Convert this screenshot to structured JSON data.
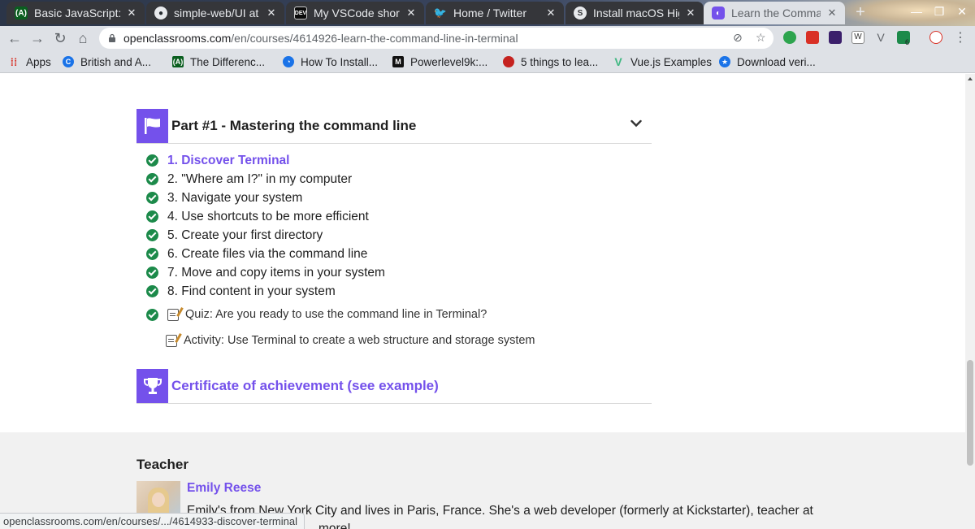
{
  "tabs": [
    {
      "title": "Basic JavaScript: Ac",
      "favicon": "freecodecamp-icon",
      "active": false
    },
    {
      "title": "simple-web/UI at m",
      "favicon": "github-icon",
      "active": false
    },
    {
      "title": "My VSCode shortcu",
      "favicon": "dev-icon",
      "active": false
    },
    {
      "title": "Home / Twitter",
      "favicon": "twitter-icon",
      "active": false
    },
    {
      "title": "Install macOS High",
      "favicon": "globe-icon",
      "active": false
    },
    {
      "title": "Learn the Comman",
      "favicon": "openclassrooms-icon",
      "active": true
    }
  ],
  "toolbar": {
    "url_host": "openclassrooms.com",
    "url_path": "/en/courses/4614926-learn-the-command-line-in-terminal"
  },
  "bookmarks": [
    {
      "label": "Apps",
      "icon": "apps-grid-icon"
    },
    {
      "label": "British and A...",
      "icon": "dictionary-icon"
    },
    {
      "label": "The Differenc...",
      "icon": "freecodecamp-icon"
    },
    {
      "label": "How To Install...",
      "icon": "digitalocean-icon"
    },
    {
      "label": "Powerlevel9k:...",
      "icon": "medium-icon"
    },
    {
      "label": "5 things to lea...",
      "icon": "red-circle-icon"
    },
    {
      "label": "Vue.js Examples",
      "icon": "vue-icon"
    },
    {
      "label": "Download veri...",
      "icon": "star-badge-icon"
    }
  ],
  "part": {
    "title": "Part #1 - Mastering the command line",
    "chapters": [
      "1. Discover Terminal",
      "2. \"Where am I?\" in my computer",
      "3. Navigate your system",
      "4. Use shortcuts to be more efficient",
      "5. Create your first directory",
      "6. Create files via the command line",
      "7. Move and copy items in your system",
      "8. Find content in your system"
    ],
    "quiz": "Quiz: Are you ready to use the command line in Terminal?",
    "activity": "Activity: Use Terminal to create a web structure and storage system"
  },
  "certificate": {
    "title": "Certificate of achievement (see example)"
  },
  "teacher": {
    "label": "Teacher",
    "name": "Emily Reese",
    "bio": "Emily's from New York City and lives in Paris, France. She's a web developer (formerly at Kickstarter), teacher at",
    "bio_tail": "more!"
  },
  "status_url": "openclassrooms.com/en/courses/.../4614933-discover-terminal",
  "colors": {
    "accent": "#7451eb",
    "check": "#1c8a4a"
  },
  "extensions_badge": "6"
}
